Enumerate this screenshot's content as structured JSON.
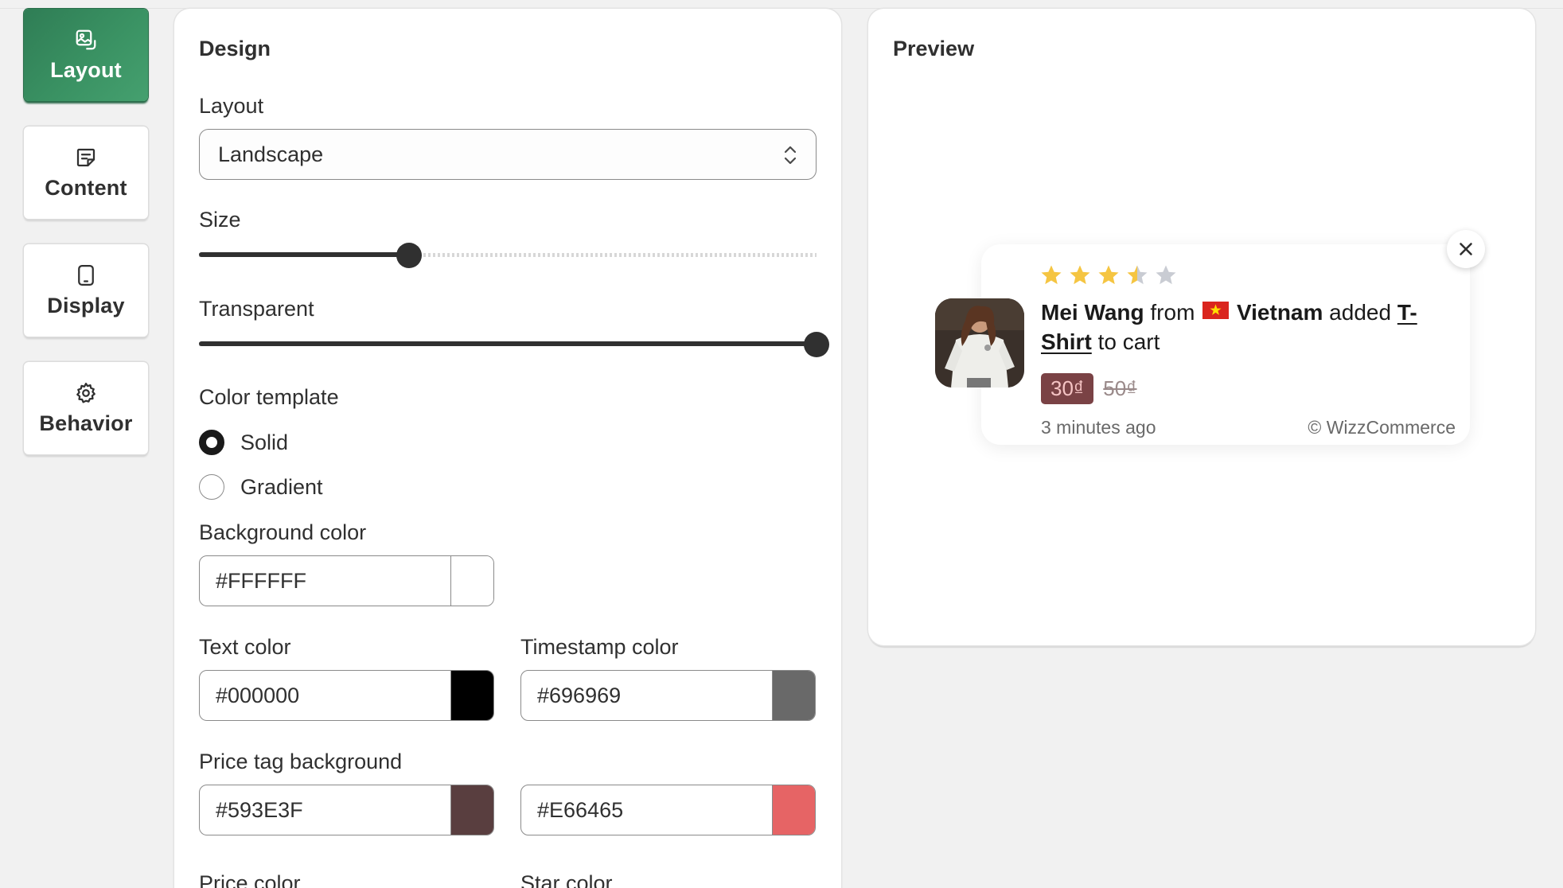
{
  "tabs": [
    {
      "label": "Layout",
      "icon": "image-icon",
      "active": true
    },
    {
      "label": "Content",
      "icon": "note-icon",
      "active": false
    },
    {
      "label": "Display",
      "icon": "tablet-icon",
      "active": false
    },
    {
      "label": "Behavior",
      "icon": "gear-icon",
      "active": false
    }
  ],
  "design": {
    "title": "Design",
    "layout_label": "Layout",
    "layout_value": "Landscape",
    "size_label": "Size",
    "size_value": 0.34,
    "transparent_label": "Transparent",
    "transparent_value": 1.0,
    "color_template_label": "Color template",
    "color_template_options": [
      "Solid",
      "Gradient"
    ],
    "color_template_selected": "Solid",
    "background_color_label": "Background color",
    "background_color": "#FFFFFF",
    "text_color_label": "Text color",
    "text_color": "#000000",
    "timestamp_color_label": "Timestamp color",
    "timestamp_color": "#696969",
    "price_tag_background_label": "Price tag background",
    "price_tag_background": "#593E3F",
    "price_tag_second_color": "#E66465",
    "price_color_label": "Price color",
    "star_color_label": "Star color"
  },
  "preview": {
    "title": "Preview",
    "rating": 3.5,
    "star_color": "#f5c542",
    "customer_name": "Mei Wang",
    "from_text": "from",
    "country": "Vietnam",
    "action_text": "added",
    "product": "T-Shirt",
    "suffix": "to cart",
    "price": "30₫",
    "old_price": "50₫",
    "timestamp": "3 minutes ago",
    "brand": "© WizzCommerce"
  },
  "colors": {
    "accent_green": "#3a8f5f",
    "text_dark": "#303030"
  }
}
